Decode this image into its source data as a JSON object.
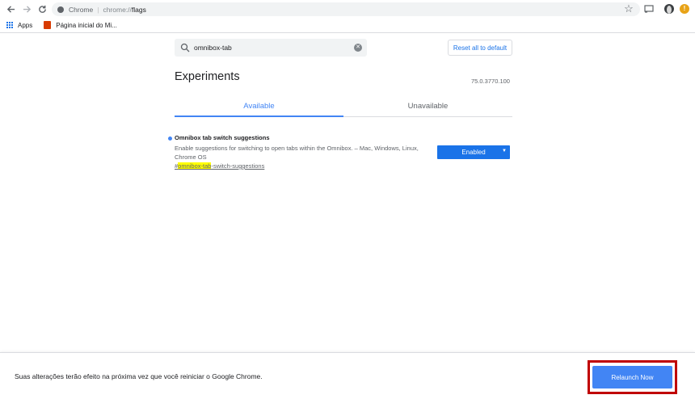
{
  "browser": {
    "site_name": "Chrome",
    "url_scheme": "chrome://",
    "url_path": "flags",
    "bookmarks": [
      {
        "label": "Apps"
      },
      {
        "label": "Página inicial do Mi..."
      }
    ]
  },
  "search": {
    "value": "omnibox-tab",
    "placeholder": "Search flags"
  },
  "reset_label": "Reset all to default",
  "page_title": "Experiments",
  "version": "75.0.3770.100",
  "tabs": [
    {
      "label": "Available",
      "active": true
    },
    {
      "label": "Unavailable",
      "active": false
    }
  ],
  "flag": {
    "name": "Omnibox tab switch suggestions",
    "description": "Enable suggestions for switching to open tabs within the Omnibox. – Mac, Windows, Linux, Chrome OS",
    "link_prefix": "#",
    "link_highlight": "omnibox-tab",
    "link_suffix": "-switch-suggestions",
    "select_value": "Enabled"
  },
  "relaunch": {
    "message": "Suas alterações terão efeito na próxima vez que você reiniciar o Google Chrome.",
    "button_label": "Relaunch Now"
  },
  "icons": {
    "back": "arrow-left-icon",
    "forward": "arrow-right-icon",
    "reload": "reload-icon",
    "site_info": "info-circle-icon",
    "bookmark_star": "star-icon",
    "search": "magnifier-icon",
    "clear": "clear-x-icon",
    "profile": "avatar-icon",
    "update": "update-icon"
  },
  "colors": {
    "accent": "#4285f4",
    "button_blue": "#1a73e8",
    "highlight": "#ffff00",
    "annotation_red": "#c00000"
  }
}
